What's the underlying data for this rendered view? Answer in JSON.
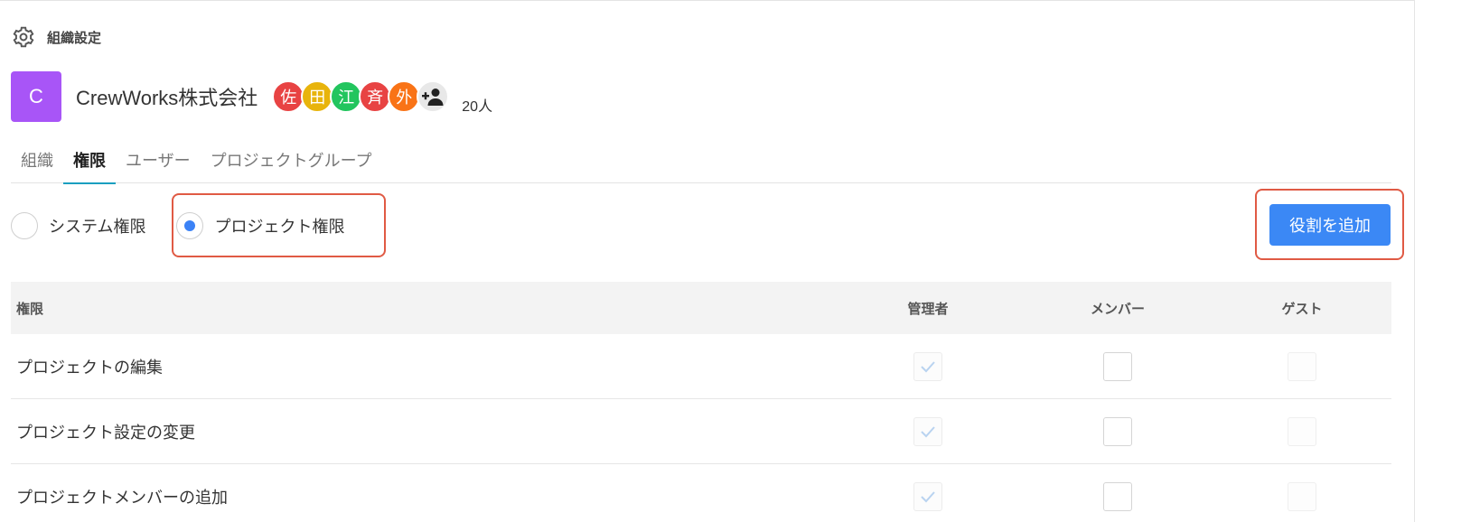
{
  "header": {
    "title": "組織設定",
    "icon": "gear-icon"
  },
  "org": {
    "avatar_letter": "C",
    "avatar_color": "#a855f7",
    "name": "CrewWorks株式会社",
    "members": [
      {
        "label": "佐",
        "color": "#e84343"
      },
      {
        "label": "田",
        "color": "#e8b40c"
      },
      {
        "label": "江",
        "color": "#22c55e"
      },
      {
        "label": "斉",
        "color": "#e84343"
      },
      {
        "label": "外",
        "color": "#f97316"
      }
    ],
    "count": "20人"
  },
  "tabs": [
    {
      "label": "組織",
      "active": false
    },
    {
      "label": "権限",
      "active": true
    },
    {
      "label": "ユーザー",
      "active": false
    },
    {
      "label": "プロジェクトグループ",
      "active": false
    }
  ],
  "radio": {
    "system_label": "システム権限",
    "project_label": "プロジェクト権限",
    "selected": "project"
  },
  "add_role_label": "役割を追加",
  "accent": "#3b88f5",
  "highlight_color": "#e05a44",
  "table": {
    "headers": [
      "権限",
      "管理者",
      "メンバー",
      "ゲスト"
    ],
    "rows": [
      {
        "name": "プロジェクトの編集",
        "admin": "checked-disabled",
        "member": "unchecked",
        "guest": "disabled"
      },
      {
        "name": "プロジェクト設定の変更",
        "admin": "checked-disabled",
        "member": "unchecked",
        "guest": "disabled"
      },
      {
        "name": "プロジェクトメンバーの追加",
        "admin": "checked-disabled",
        "member": "unchecked",
        "guest": "disabled"
      }
    ]
  }
}
